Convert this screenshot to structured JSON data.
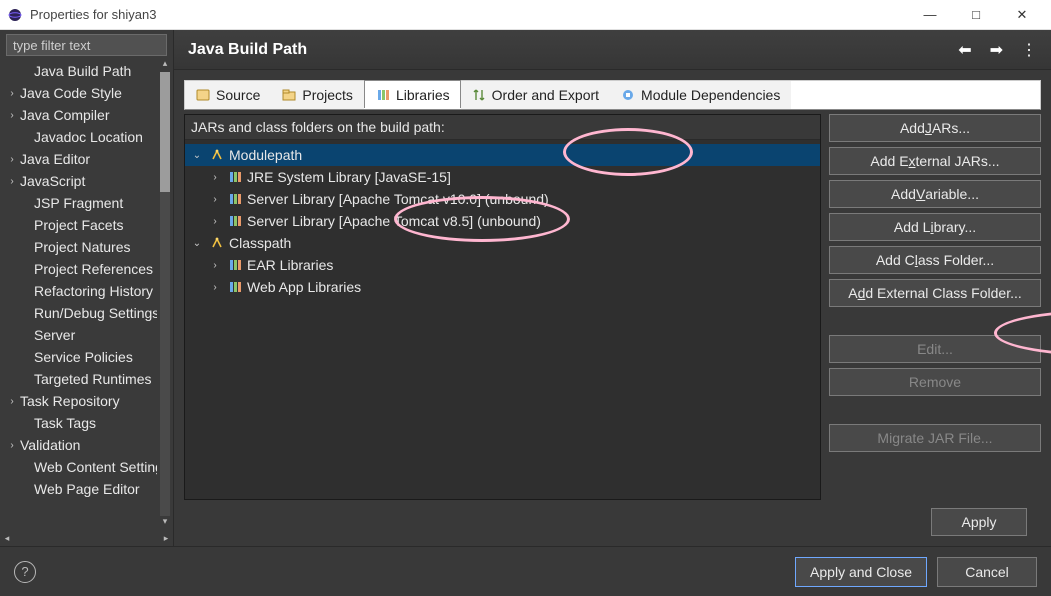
{
  "window": {
    "title": "Properties for shiyan3",
    "minimize": "—",
    "maximize": "□",
    "close": "✕"
  },
  "filter": {
    "placeholder": "type filter text"
  },
  "sidebar": {
    "items": [
      {
        "label": "Java Build Path",
        "expandable": false,
        "selected": false,
        "indent": 1
      },
      {
        "label": "Java Code Style",
        "expandable": true
      },
      {
        "label": "Java Compiler",
        "expandable": true
      },
      {
        "label": "Javadoc Location",
        "expandable": false,
        "indent": 1
      },
      {
        "label": "Java Editor",
        "expandable": true
      },
      {
        "label": "JavaScript",
        "expandable": true
      },
      {
        "label": "JSP Fragment",
        "expandable": false,
        "indent": 1
      },
      {
        "label": "Project Facets",
        "expandable": false,
        "indent": 1
      },
      {
        "label": "Project Natures",
        "expandable": false,
        "indent": 1
      },
      {
        "label": "Project References",
        "expandable": false,
        "indent": 1
      },
      {
        "label": "Refactoring History",
        "expandable": false,
        "indent": 1
      },
      {
        "label": "Run/Debug Settings",
        "expandable": false,
        "indent": 1
      },
      {
        "label": "Server",
        "expandable": false,
        "indent": 1
      },
      {
        "label": "Service Policies",
        "expandable": false,
        "indent": 1
      },
      {
        "label": "Targeted Runtimes",
        "expandable": false,
        "indent": 1
      },
      {
        "label": "Task Repository",
        "expandable": true
      },
      {
        "label": "Task Tags",
        "expandable": false,
        "indent": 1
      },
      {
        "label": "Validation",
        "expandable": true
      },
      {
        "label": "Web Content Settings",
        "expandable": false,
        "indent": 1
      },
      {
        "label": "Web Page Editor",
        "expandable": false,
        "indent": 1
      }
    ]
  },
  "header": {
    "title": "Java Build Path"
  },
  "tabs": [
    {
      "label": "Source",
      "icon": "source-icon"
    },
    {
      "label": "Projects",
      "icon": "projects-icon"
    },
    {
      "label": "Libraries",
      "icon": "libraries-icon",
      "active": true
    },
    {
      "label": "Order and Export",
      "icon": "order-icon"
    },
    {
      "label": "Module Dependencies",
      "icon": "module-icon"
    }
  ],
  "build": {
    "caption": "JARs and class folders on the build path:",
    "tree": [
      {
        "label": "Modulepath",
        "level": 0,
        "expanded": true,
        "icon": "modulepath-icon",
        "selected": true
      },
      {
        "label": "JRE System Library [JavaSE-15]",
        "level": 1,
        "expandable": true,
        "icon": "library-icon"
      },
      {
        "label": "Server Library [Apache Tomcat v10.0] (unbound)",
        "level": 1,
        "expandable": true,
        "icon": "library-icon"
      },
      {
        "label": "Server Library [Apache Tomcat v8.5] (unbound)",
        "level": 1,
        "expandable": true,
        "icon": "library-icon"
      },
      {
        "label": "Classpath",
        "level": 0,
        "expanded": true,
        "icon": "modulepath-icon"
      },
      {
        "label": "EAR Libraries",
        "level": 1,
        "expandable": true,
        "icon": "library-icon"
      },
      {
        "label": "Web App Libraries",
        "level": 1,
        "expandable": true,
        "icon": "library-icon"
      }
    ],
    "buttons": [
      {
        "label": "Add JARs...",
        "underline": "J",
        "disabled": false
      },
      {
        "label": "Add External JARs...",
        "underline": "x",
        "disabled": false
      },
      {
        "label": "Add Variable...",
        "underline": "V",
        "disabled": false
      },
      {
        "label": "Add Library...",
        "underline": "i",
        "disabled": false,
        "highlight": true
      },
      {
        "label": "Add Class Folder...",
        "underline": "l",
        "disabled": false
      },
      {
        "label": "Add External Class Folder...",
        "underline": "d",
        "disabled": false
      },
      {
        "_spacer": true
      },
      {
        "label": "Edit...",
        "disabled": true
      },
      {
        "label": "Remove",
        "disabled": true
      },
      {
        "_spacer": true
      },
      {
        "label": "Migrate JAR File...",
        "disabled": true
      }
    ],
    "apply": "Apply"
  },
  "dialog": {
    "help": "?",
    "apply_close": "Apply and Close",
    "cancel": "Cancel"
  }
}
